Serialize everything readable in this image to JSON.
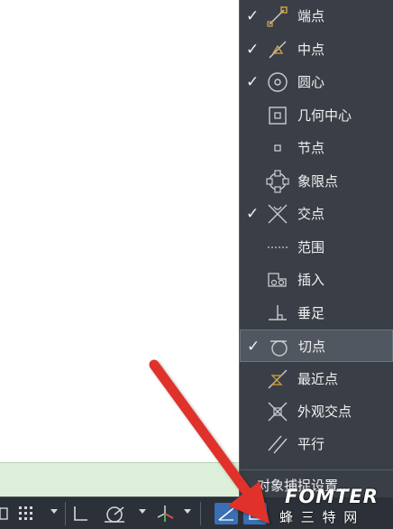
{
  "osnap_menu": {
    "items": [
      {
        "label": "端点",
        "checked": true,
        "icon": "endpoint-icon"
      },
      {
        "label": "中点",
        "checked": true,
        "icon": "midpoint-icon"
      },
      {
        "label": "圆心",
        "checked": true,
        "icon": "center-icon"
      },
      {
        "label": "几何中心",
        "checked": false,
        "icon": "geometric-center-icon"
      },
      {
        "label": "节点",
        "checked": false,
        "icon": "node-icon"
      },
      {
        "label": "象限点",
        "checked": false,
        "icon": "quadrant-icon"
      },
      {
        "label": "交点",
        "checked": true,
        "icon": "intersection-icon"
      },
      {
        "label": "范围",
        "checked": false,
        "icon": "extension-icon"
      },
      {
        "label": "插入",
        "checked": false,
        "icon": "insertion-icon"
      },
      {
        "label": "垂足",
        "checked": false,
        "icon": "perpendicular-icon"
      },
      {
        "label": "切点",
        "checked": true,
        "icon": "tangent-icon",
        "highlighted": true
      },
      {
        "label": "最近点",
        "checked": false,
        "icon": "nearest-icon"
      },
      {
        "label": "外观交点",
        "checked": false,
        "icon": "apparent-intersection-icon"
      },
      {
        "label": "平行",
        "checked": false,
        "icon": "parallel-icon"
      }
    ],
    "settings_label": "对象捕捉设置...",
    "check_mark": "✓"
  },
  "watermark": {
    "brand": "FOMTER",
    "subtitle": "蜂 三 特  网"
  },
  "colors": {
    "menu_bg": "#3a3f47",
    "status_bar_bg": "#2c3139",
    "command_strip": "#dcefd8",
    "active_button": "#3b6fb5",
    "snap_marker": "#d9a441",
    "arrow": "#e0302a"
  }
}
